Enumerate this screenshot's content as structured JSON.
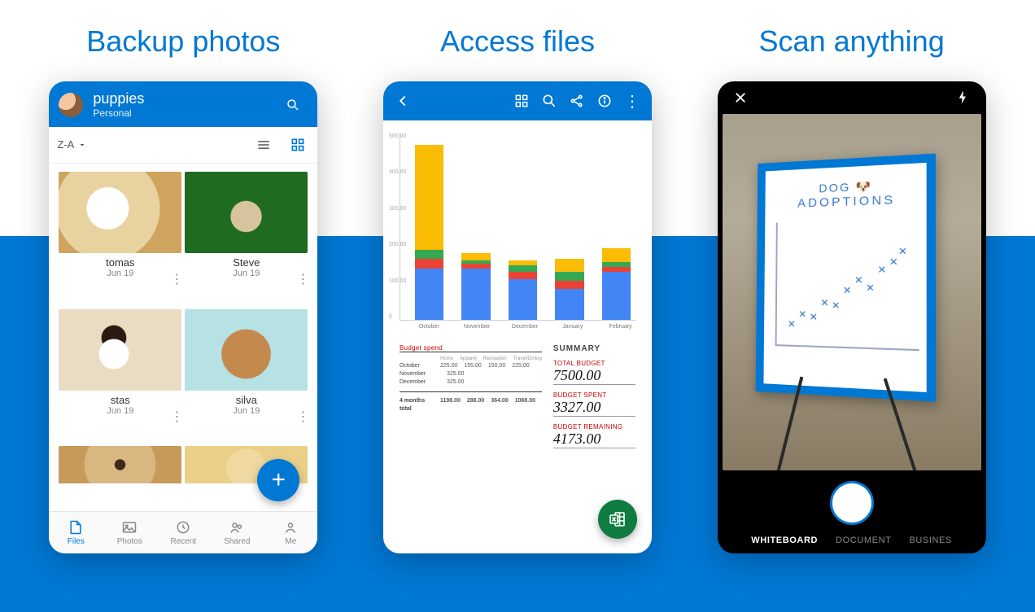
{
  "headlines": [
    "Backup photos",
    "Access files",
    "Scan anything"
  ],
  "phone1": {
    "title": "puppies",
    "subtitle": "Personal",
    "sort_label": "Z-A",
    "items": [
      {
        "name": "tomas",
        "date": "Jun 19"
      },
      {
        "name": "Steve",
        "date": "Jun 19"
      },
      {
        "name": "stas",
        "date": "Jun 19"
      },
      {
        "name": "silva",
        "date": "Jun 19"
      }
    ],
    "tabs": [
      "Files",
      "Photos",
      "Recent",
      "Shared",
      "Me"
    ],
    "active_tab": 0
  },
  "phone2": {
    "chart_data": {
      "type": "bar-stacked",
      "categories": [
        "October",
        "November",
        "December",
        "January",
        "February"
      ],
      "series": [
        {
          "name": "Home",
          "color": "#4285f4",
          "values": [
            150,
            150,
            120,
            90,
            140
          ]
        },
        {
          "name": "Apparel",
          "color": "#ea4335",
          "values": [
            30,
            15,
            20,
            25,
            15
          ]
        },
        {
          "name": "Recreation",
          "color": "#34a853",
          "values": [
            25,
            10,
            20,
            25,
            15
          ]
        },
        {
          "name": "Travel/Dining",
          "color": "#fbbc05",
          "values": [
            310,
            20,
            15,
            40,
            40
          ]
        }
      ],
      "ylim": [
        0,
        550
      ],
      "y_ticks": [
        "500.00",
        "400.00",
        "300.00",
        "200.00",
        "100.00",
        "0"
      ]
    },
    "table": {
      "header": "Budget spend",
      "cols": [
        "",
        "Home",
        "Apparel",
        "Recreation",
        "Travel/Dining"
      ],
      "rows": [
        [
          "October",
          "225.00",
          "155.00",
          "150.00",
          "225.00"
        ],
        [
          "November",
          "",
          "325.00",
          "",
          ""
        ],
        [
          "December",
          "",
          "325.00",
          "",
          ""
        ]
      ],
      "footer": [
        "4 months total",
        "1198.00",
        "288.00",
        "364.00",
        "1068.00"
      ]
    },
    "summary": {
      "heading": "SUMMARY",
      "total_budget_label": "TOTAL BUDGET",
      "total_budget_value": "7500.00",
      "spent_label": "BUDGET SPENT",
      "spent_value": "3327.00",
      "remaining_label": "BUDGET REMAINING",
      "remaining_value": "4173.00"
    }
  },
  "phone3": {
    "whiteboard_title": "DOG",
    "whiteboard_subtitle": "ADOPTIONS",
    "modes": [
      "WHITEBOARD",
      "DOCUMENT",
      "BUSINES"
    ],
    "active_mode": 0
  },
  "colors": {
    "brand": "#0078d4",
    "excel_green": "#107c41"
  }
}
